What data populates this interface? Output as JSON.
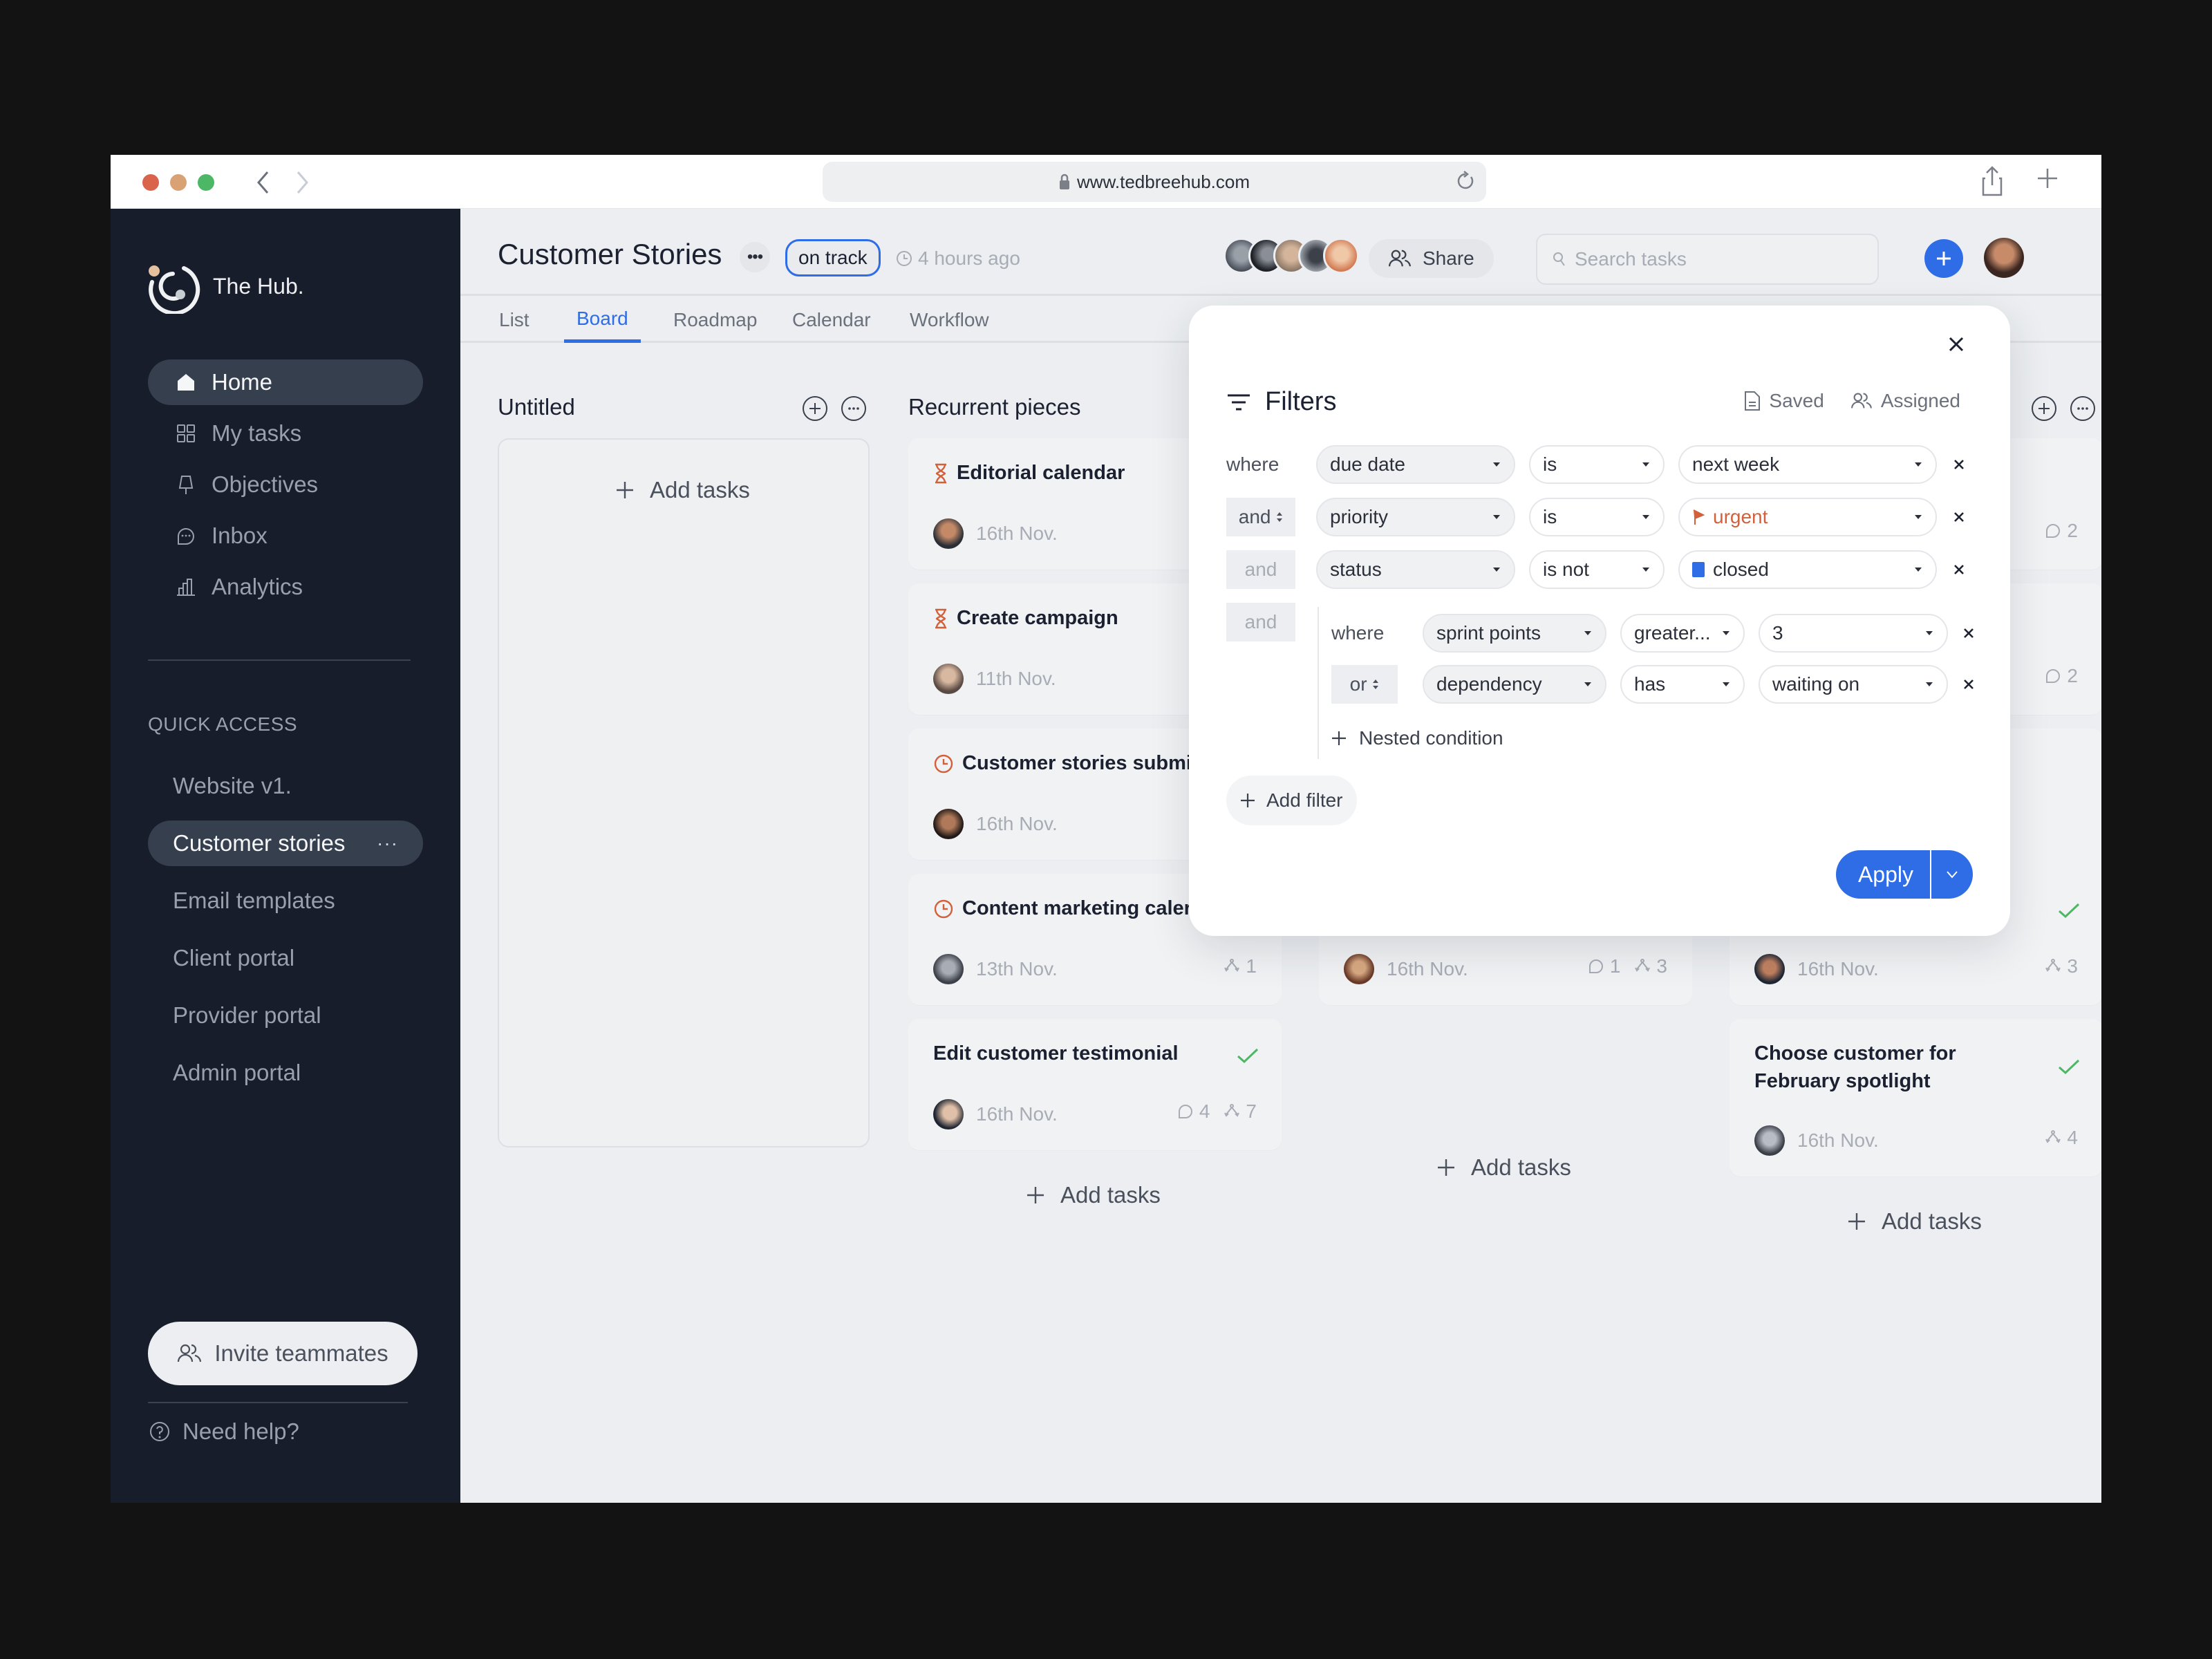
{
  "browser": {
    "url": "www.tedbreehub.com"
  },
  "sidebar": {
    "brand": "The Hub.",
    "nav": [
      {
        "label": "Home",
        "icon": "home-icon",
        "active": true
      },
      {
        "label": "My tasks",
        "icon": "grid-icon",
        "active": false
      },
      {
        "label": "Objectives",
        "icon": "pin-icon",
        "active": false
      },
      {
        "label": "Inbox",
        "icon": "chat-icon",
        "active": false
      },
      {
        "label": "Analytics",
        "icon": "bar-chart-icon",
        "active": false
      }
    ],
    "quick_access_label": "QUICK ACCESS",
    "quick_access": [
      {
        "label": "Website v1.",
        "active": false
      },
      {
        "label": "Customer stories",
        "active": true,
        "more": "···"
      },
      {
        "label": "Email templates",
        "active": false
      },
      {
        "label": "Client portal",
        "active": false
      },
      {
        "label": "Provider portal",
        "active": false
      },
      {
        "label": "Admin portal",
        "active": false
      }
    ],
    "invite_label": "Invite teammates",
    "help_label": "Need help?"
  },
  "header": {
    "title": "Customer Stories",
    "more": "•••",
    "status": "on track",
    "updated": "4 hours ago",
    "share_label": "Share",
    "search_placeholder": "Search tasks"
  },
  "tabs": [
    {
      "label": "List",
      "active": false
    },
    {
      "label": "Board",
      "active": true
    },
    {
      "label": "Roadmap",
      "active": false
    },
    {
      "label": "Calendar",
      "active": false
    },
    {
      "label": "Workflow",
      "active": false
    }
  ],
  "board": {
    "add_tasks_label": "Add tasks",
    "columns": [
      {
        "title": "Untitled",
        "cards": []
      },
      {
        "title": "Recurrent pieces",
        "cards": [
          {
            "title": "Editorial calendar",
            "status_icon": "hourglass-icon",
            "date": "16th Nov.",
            "comments": "",
            "subtasks": ""
          },
          {
            "title": "Create campaign",
            "status_icon": "hourglass-icon",
            "date": "11th Nov.",
            "comments": "",
            "subtasks": ""
          },
          {
            "title": "Customer stories submis",
            "status_icon": "clock-icon",
            "date": "16th Nov.",
            "comments": "",
            "subtasks": ""
          },
          {
            "title": "Content marketing  caler",
            "status_icon": "clock-icon",
            "date": "13th Nov.",
            "comments": "",
            "subtasks": "1"
          },
          {
            "title": "Edit customer testimonial",
            "status_icon": "check-icon",
            "date": "16th Nov.",
            "comments": "4",
            "subtasks": "7"
          }
        ]
      },
      {
        "title": "",
        "cards": [
          {
            "title": "",
            "date": "16th Nov.",
            "comments": "1",
            "subtasks": "3"
          }
        ]
      },
      {
        "title": "",
        "cards": [
          {
            "title": "",
            "date": "",
            "comments": "2",
            "subtasks": ""
          },
          {
            "title": "",
            "date": "",
            "comments": "2",
            "subtasks": ""
          },
          {
            "title": "",
            "status_icon": "check-icon",
            "date": "16th Nov.",
            "comments": "",
            "subtasks": "3"
          },
          {
            "title": "Choose customer for February spotlight",
            "status_icon": "check-icon",
            "date": "16th Nov.",
            "comments": "",
            "subtasks": "4"
          }
        ]
      }
    ]
  },
  "filters": {
    "title": "Filters",
    "saved_label": "Saved",
    "assigned_label": "Assigned",
    "rows": [
      {
        "conjunction": "where",
        "field": "due date",
        "operator": "is",
        "value": "next week"
      },
      {
        "conjunction": "and",
        "field": "priority",
        "operator": "is",
        "value": "urgent",
        "value_color": "#d2603a"
      },
      {
        "conjunction": "and",
        "field": "status",
        "operator": "is not",
        "value": "closed",
        "value_color": "#2f6de6"
      }
    ],
    "group": {
      "conjunction": "and",
      "rows": [
        {
          "conjunction": "where",
          "field": "sprint points",
          "operator": "greater...",
          "value": "3"
        },
        {
          "conjunction": "or",
          "field": "dependency",
          "operator": "has",
          "value": "waiting on"
        }
      ],
      "nested_label": "Nested condition"
    },
    "add_filter_label": "Add filter",
    "apply_label": "Apply"
  },
  "colors": {
    "accent": "#2f6de6",
    "sidebar_bg": "#171d2b",
    "urgent": "#d2603a",
    "done": "#4cb765"
  }
}
